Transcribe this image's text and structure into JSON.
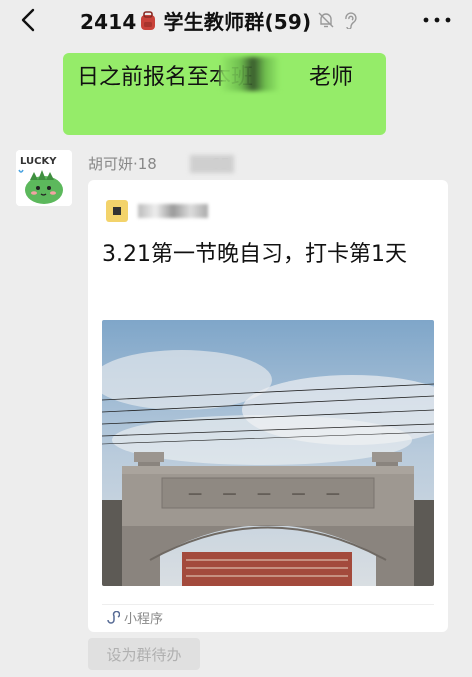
{
  "header": {
    "title_prefix": "2414",
    "title_suffix": "学生教师群(59)",
    "back_icon": "chevron-left-icon",
    "mute_icon": "bell-off-icon",
    "ear_icon": "ear-icon",
    "more_icon": "more-dots-icon"
  },
  "messages": {
    "green_text": "日之前报名至本班",
    "green_tail": "老师",
    "sender_name": "胡可妍·18",
    "sender_tail": "65",
    "card_title": "3.21第一节晚自习，打卡第1天",
    "card_badge": "小程序",
    "photo_caption_icon": "school-gate-photo"
  },
  "actions": {
    "todo_label": "设为群待办"
  },
  "colors": {
    "background": "#ededed",
    "bubble_green": "#95ec69",
    "card_white": "#ffffff"
  }
}
